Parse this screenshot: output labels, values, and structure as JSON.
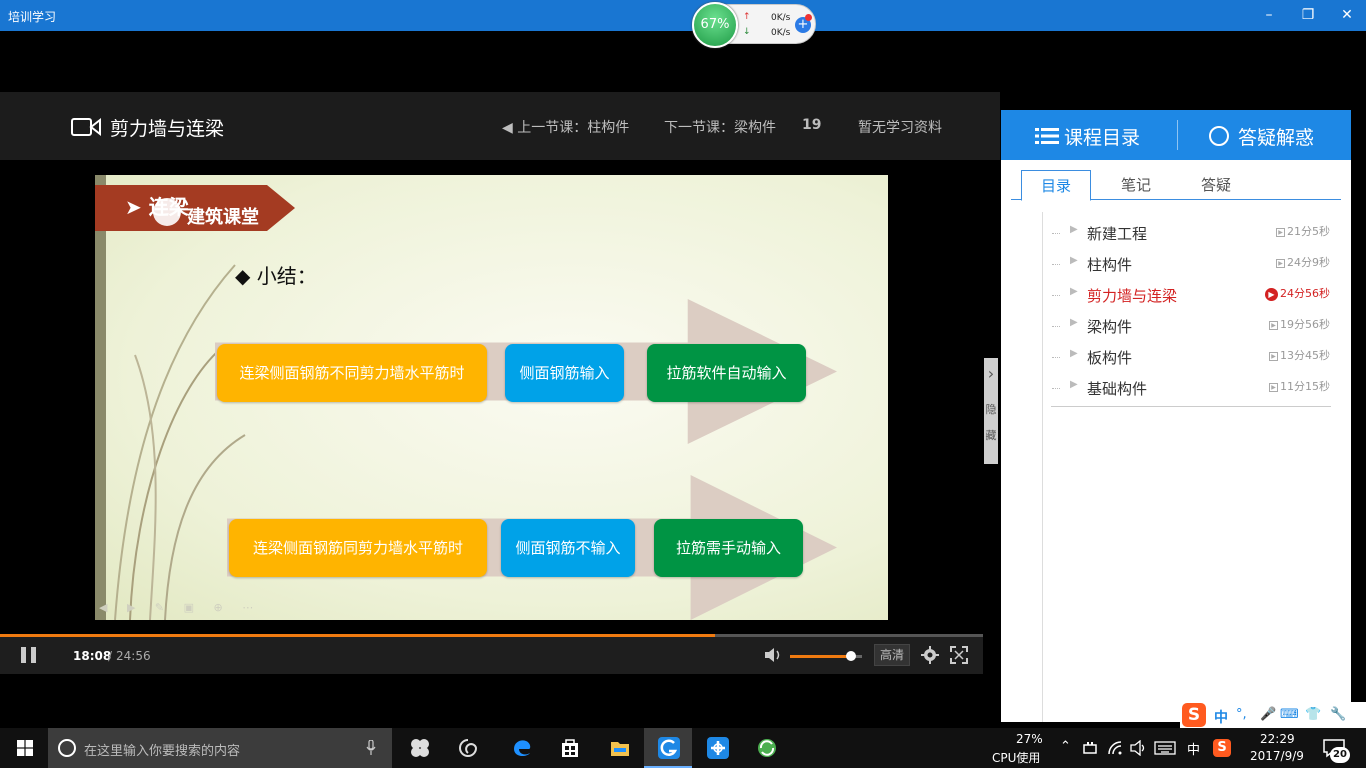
{
  "window": {
    "title": "培训学习",
    "minimize": "–",
    "restore": "❐",
    "close": "✕"
  },
  "network": {
    "percent": "67%",
    "up_speed": "0K/s",
    "down_speed": "0K/s",
    "plus": "+"
  },
  "header": {
    "course_title": "剪力墙与连梁",
    "prev_lesson": "◀ 上一节课：柱构件",
    "next_lesson": "下一节课：梁构件",
    "count": "19",
    "materials": "暂无学习资料"
  },
  "slide": {
    "banner": "➤ 连梁",
    "logo_text": "建筑课堂",
    "summary": "◆ 小结：",
    "row1": [
      "连梁侧面钢筋不同剪力墙水平筋时",
      "侧面钢筋输入",
      "拉筋软件自动输入"
    ],
    "row2": [
      "连梁侧面钢筋同剪力墙水平筋时",
      "侧面钢筋不输入",
      "拉筋需手动输入"
    ],
    "colors": {
      "orange": "#ffb400",
      "blue": "#00a2e8",
      "green": "#009444"
    }
  },
  "player": {
    "current_time": "18:08",
    "separator": "/",
    "total_time": "24:56",
    "progress": 0.727,
    "volume": 0.85,
    "quality": "高清"
  },
  "hide_toggle": {
    "arrow": "›",
    "label": "隐藏"
  },
  "panel": {
    "tab_catalog": "课程目录",
    "tab_qa": "答疑解惑",
    "subtabs": [
      "目录",
      "笔记",
      "答疑"
    ],
    "lessons": [
      {
        "name": "新建工程",
        "duration": "21分5秒",
        "active": false
      },
      {
        "name": "柱构件",
        "duration": "24分9秒",
        "active": false
      },
      {
        "name": "剪力墙与连梁",
        "duration": "24分56秒",
        "active": true
      },
      {
        "name": "梁构件",
        "duration": "19分56秒",
        "active": false
      },
      {
        "name": "板构件",
        "duration": "13分45秒",
        "active": false
      },
      {
        "name": "基础构件",
        "duration": "11分15秒",
        "active": false
      }
    ]
  },
  "ime": {
    "logo": "S",
    "lang": "中",
    "punct": "°,",
    "symbols": [
      "🎤",
      "⌨",
      "👕",
      "🔧"
    ]
  },
  "taskbar": {
    "search_placeholder": "在这里输入你要搜索的内容",
    "cpu_percent": "27%",
    "cpu_label": "CPU使用",
    "tray_chevron": "⌃",
    "ime_lang": "中",
    "time": "22:29",
    "date": "2017/9/9",
    "notifications": "20"
  }
}
